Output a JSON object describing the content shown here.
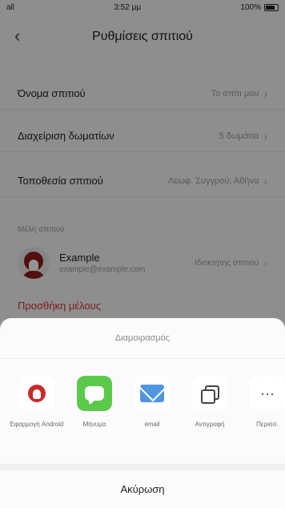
{
  "status": {
    "carrier": "all",
    "time": "3:52 μμ",
    "battery": "100%"
  },
  "nav": {
    "back": "‹",
    "title": "Ρυθμίσεις σπιτιού"
  },
  "settings": [
    {
      "label": "Όνομα σπιτιού",
      "value": "Το σπίτι μου"
    },
    {
      "label": "Διαχείριση δωματίων",
      "value": "5 δωμάτια"
    },
    {
      "label": "Τοποθεσία σπιτιού",
      "value": "Λεωφ. Συγγρού, Αθήνα"
    }
  ],
  "members_section_label": "Μέλη σπιτιού",
  "member": {
    "name": "Example",
    "email": "example@example.com",
    "role": "Ιδιοκτήτης σπιτιού"
  },
  "add_member_label": "Προσθήκη μέλους",
  "share_sheet": {
    "title": "Διαμοιρασμός",
    "apps": [
      {
        "label": "Εφαρμογή Android",
        "icon": "app-logo-icon"
      },
      {
        "label": "Μήνυμα",
        "icon": "messages-icon"
      },
      {
        "label": "email",
        "icon": "mail-icon"
      },
      {
        "label": "Αντιγραφή",
        "icon": "copy-icon"
      },
      {
        "label": "Περισσ.",
        "icon": "more-icon"
      }
    ],
    "cancel_label": "Ακύρωση"
  }
}
